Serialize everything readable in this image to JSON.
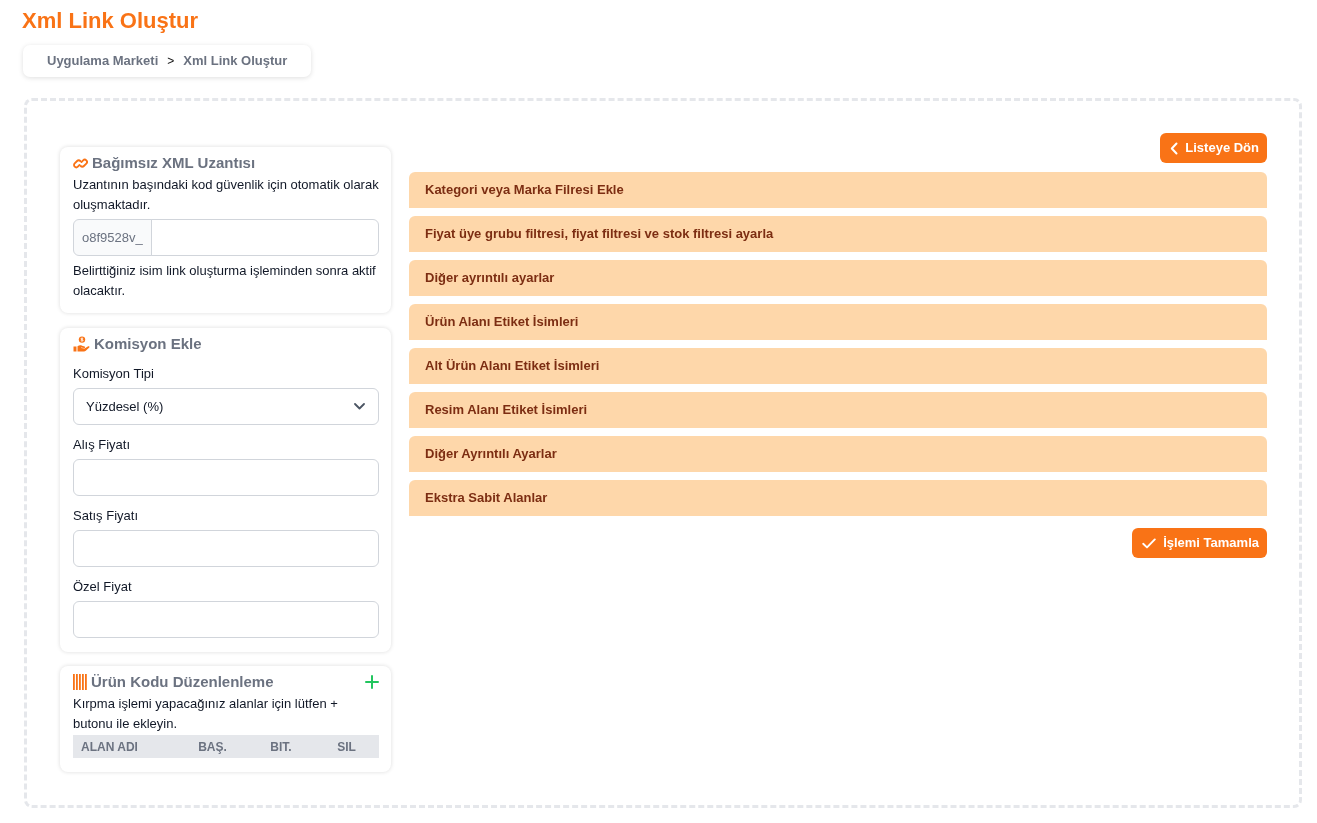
{
  "page_title": "Xml Link Oluştur",
  "breadcrumb": {
    "items": [
      {
        "label": "Uygulama Marketi"
      },
      {
        "label": "Xml Link Oluştur"
      }
    ],
    "separator": ">"
  },
  "xml_extension_card": {
    "title": "Bağımsız XML Uzantısı",
    "description": "Uzantının başındaki kod güvenlik için otomatik olarak oluşmaktadır.",
    "prefix": "o8f9528v_",
    "hint": "Belirttiğiniz isim link oluşturma işleminden sonra aktif olacaktır."
  },
  "commission_card": {
    "title": "Komisyon Ekle",
    "fields": [
      {
        "kind": "select",
        "label": "Komisyon Tipi",
        "value": "Yüzdesel (%)"
      },
      {
        "kind": "input",
        "label": "Alış Fiyatı"
      },
      {
        "kind": "input",
        "label": "Satış Fiyatı"
      },
      {
        "kind": "input",
        "label": "Özel Fiyat"
      }
    ]
  },
  "product_code_card": {
    "title": "Ürün Kodu Düzenlenleme",
    "description": "Kırpma işlemi yapacağınız alanlar için lütfen + butonu ile ekleyin.",
    "table": {
      "columns": [
        "ALAN ADI",
        "BAŞ.",
        "BIT.",
        "SIL"
      ]
    }
  },
  "back_button": {
    "label": "Listeye Dön"
  },
  "accordion_sections": [
    {
      "title": "Kategori veya Marka Filresi Ekle"
    },
    {
      "title": "Fiyat üye grubu filtresi, fiyat filtresi ve stok filtresi ayarla"
    },
    {
      "title": "Diğer ayrıntılı ayarlar"
    },
    {
      "title": "Ürün Alanı Etiket İsimleri"
    },
    {
      "title": "Alt Ürün Alanı Etiket İsimleri"
    },
    {
      "title": "Resim Alanı Etiket İsimleri"
    },
    {
      "title": "Diğer Ayrıntılı Ayarlar"
    },
    {
      "title": "Ekstra Sabit Alanlar"
    }
  ],
  "submit_button": {
    "label": "İşlemi Tamamla"
  }
}
